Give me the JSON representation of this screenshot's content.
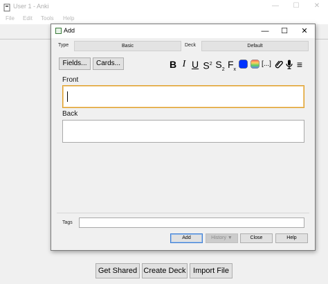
{
  "main_window": {
    "title": "User 1 - Anki",
    "menu": [
      "File",
      "Edit",
      "Tools",
      "Help"
    ],
    "controls": {
      "minimize": "—",
      "maximize": "☐",
      "close": "✕"
    },
    "bottom_buttons": [
      "Get Shared",
      "Create Deck",
      "Import File"
    ]
  },
  "dialog": {
    "title": "Add",
    "controls": {
      "minimize": "—",
      "maximize": "☐",
      "close": "✕"
    },
    "type_label": "Type",
    "type_value": "Basic",
    "deck_label": "Deck",
    "deck_value": "Default",
    "fields_button": "Fields...",
    "cards_button": "Cards...",
    "format_tools": {
      "bold": "B",
      "italic": "I",
      "underline": "U",
      "superscript_base": "S",
      "superscript_mark": "2",
      "subscript_base": "S",
      "subscript_mark": "2",
      "clear_format_base": "F",
      "clear_format_mark": "x",
      "cloze": "[...]",
      "menu": "≡"
    },
    "text_color": "#0033ff",
    "fields": [
      {
        "label": "Front",
        "value": ""
      },
      {
        "label": "Back",
        "value": ""
      }
    ],
    "tags_label": "Tags",
    "tags_value": "",
    "buttons": {
      "add": "Add",
      "history": "History ▼",
      "close": "Close",
      "help": "Help"
    }
  }
}
